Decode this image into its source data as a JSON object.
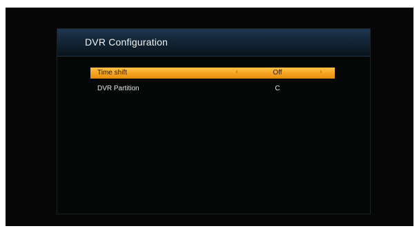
{
  "screen": {
    "title": "DVR Configuration"
  },
  "menu": {
    "items": [
      {
        "label": "Time shift",
        "value": "Off",
        "left_arrow": "‹",
        "right_arrow": "›",
        "selected": true
      },
      {
        "label": "DVR Partition",
        "value": "C",
        "selected": false
      }
    ]
  },
  "colors": {
    "highlight": "#f5a21d",
    "header": "#1e3550",
    "background": "#060606"
  }
}
